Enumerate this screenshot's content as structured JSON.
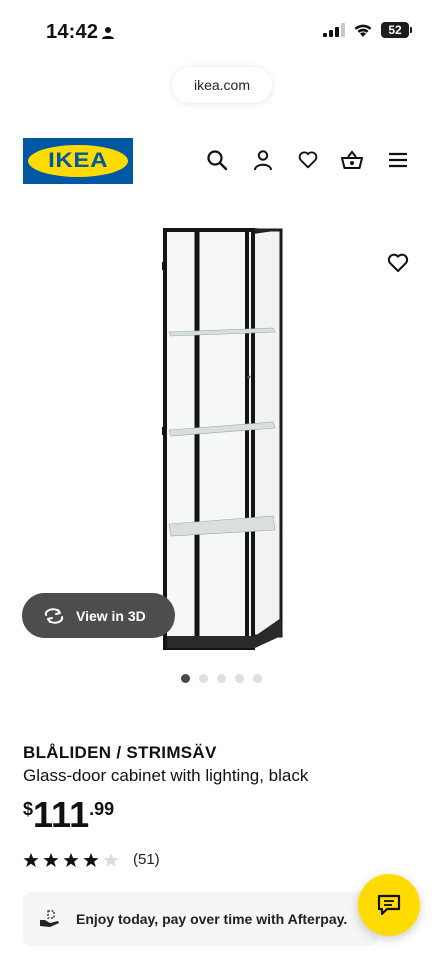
{
  "status_bar": {
    "time": "14:42",
    "battery": "52"
  },
  "browser": {
    "url": "ikea.com"
  },
  "header": {
    "logo_text": "IKEA",
    "icons": [
      "search-icon",
      "account-icon",
      "wishlist-icon",
      "basket-icon",
      "menu-icon"
    ]
  },
  "gallery": {
    "view_3d_label": "View in 3D",
    "image_count": 5,
    "active_index": 0
  },
  "product": {
    "name": "BLÅLIDEN / STRIMSÄV",
    "description": "Glass-door cabinet with lighting, black",
    "price_currency": "$",
    "price_main": "111",
    "price_decimal": ".99",
    "rating": 4,
    "rating_max": 5,
    "review_count": "(51)"
  },
  "afterpay": {
    "text": "Enjoy today, pay over time with Afterpay."
  },
  "colors": {
    "ikea_blue": "#0058a3",
    "ikea_yellow": "#ffdb00"
  }
}
